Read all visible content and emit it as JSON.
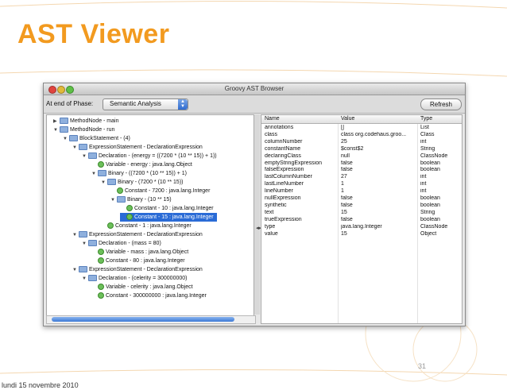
{
  "slide": {
    "title": "AST Viewer",
    "footer_date": "lundi 15 novembre 2010",
    "page_number": "31"
  },
  "window": {
    "title": "Groovy AST Browser",
    "phase_label": "At end of Phase:",
    "phase_value": "Semantic Analysis",
    "refresh_label": "Refresh"
  },
  "tree": [
    {
      "label": "MethodNode - main",
      "depth": 0,
      "expanded": false,
      "kind": "folder"
    },
    {
      "label": "MethodNode - run",
      "depth": 0,
      "expanded": true,
      "kind": "folder"
    },
    {
      "label": "BlockStatement - (4)",
      "depth": 1,
      "expanded": true,
      "kind": "folder"
    },
    {
      "label": "ExpressionStatement - DeclarationExpression",
      "depth": 2,
      "expanded": true,
      "kind": "folder"
    },
    {
      "label": "Declaration - (energy = ((7200 * (10 ** 15)) + 1))",
      "depth": 3,
      "expanded": true,
      "kind": "folder"
    },
    {
      "label": "Variable - energy : java.lang.Object",
      "depth": 4,
      "kind": "leaf"
    },
    {
      "label": "Binary - ((7200 * (10 ** 15)) + 1)",
      "depth": 4,
      "expanded": true,
      "kind": "folder"
    },
    {
      "label": "Binary - (7200 * (10 ** 15))",
      "depth": 5,
      "expanded": true,
      "kind": "folder"
    },
    {
      "label": "Constant - 7200 : java.lang.Integer",
      "depth": 6,
      "kind": "leaf"
    },
    {
      "label": "Binary - (10 ** 15)",
      "depth": 6,
      "expanded": true,
      "kind": "folder"
    },
    {
      "label": "Constant - 10 : java.lang.Integer",
      "depth": 7,
      "kind": "leaf"
    },
    {
      "label": "Constant - 15 : java.lang.Integer",
      "depth": 7,
      "kind": "leaf",
      "selected": true
    },
    {
      "label": "Constant - 1 : java.lang.Integer",
      "depth": 5,
      "kind": "leaf"
    },
    {
      "label": "ExpressionStatement - DeclarationExpression",
      "depth": 2,
      "expanded": true,
      "kind": "folder"
    },
    {
      "label": "Declaration - (mass = 80)",
      "depth": 3,
      "expanded": true,
      "kind": "folder"
    },
    {
      "label": "Variable - mass : java.lang.Object",
      "depth": 4,
      "kind": "leaf"
    },
    {
      "label": "Constant - 80 : java.lang.Integer",
      "depth": 4,
      "kind": "leaf"
    },
    {
      "label": "ExpressionStatement - DeclarationExpression",
      "depth": 2,
      "expanded": true,
      "kind": "folder"
    },
    {
      "label": "Declaration - (celerity = 300000000)",
      "depth": 3,
      "expanded": true,
      "kind": "folder"
    },
    {
      "label": "Variable - celerity : java.lang.Object",
      "depth": 4,
      "kind": "leaf"
    },
    {
      "label": "Constant - 300000000 : java.lang.Integer",
      "depth": 4,
      "kind": "leaf"
    }
  ],
  "table": {
    "headers": [
      "Name",
      "Value",
      "Type"
    ],
    "rows": [
      [
        "annotations",
        "[]",
        "List"
      ],
      [
        "class",
        "class org.codehaus.groo...",
        "Class"
      ],
      [
        "columnNumber",
        "25",
        "int"
      ],
      [
        "constantName",
        "$const$2",
        "String"
      ],
      [
        "declaringClass",
        "null",
        "ClassNode"
      ],
      [
        "emptyStringExpression",
        "false",
        "boolean"
      ],
      [
        "falseExpression",
        "false",
        "boolean"
      ],
      [
        "lastColumnNumber",
        "27",
        "int"
      ],
      [
        "lastLineNumber",
        "1",
        "int"
      ],
      [
        "lineNumber",
        "1",
        "int"
      ],
      [
        "nullExpression",
        "false",
        "boolean"
      ],
      [
        "synthetic",
        "false",
        "boolean"
      ],
      [
        "text",
        "15",
        "String"
      ],
      [
        "trueExpression",
        "false",
        "boolean"
      ],
      [
        "type",
        "java.lang.Integer",
        "ClassNode"
      ],
      [
        "value",
        "15",
        "Object"
      ]
    ]
  },
  "colors": {
    "title": "#f29a1f",
    "selection": "#2a6bd6"
  }
}
